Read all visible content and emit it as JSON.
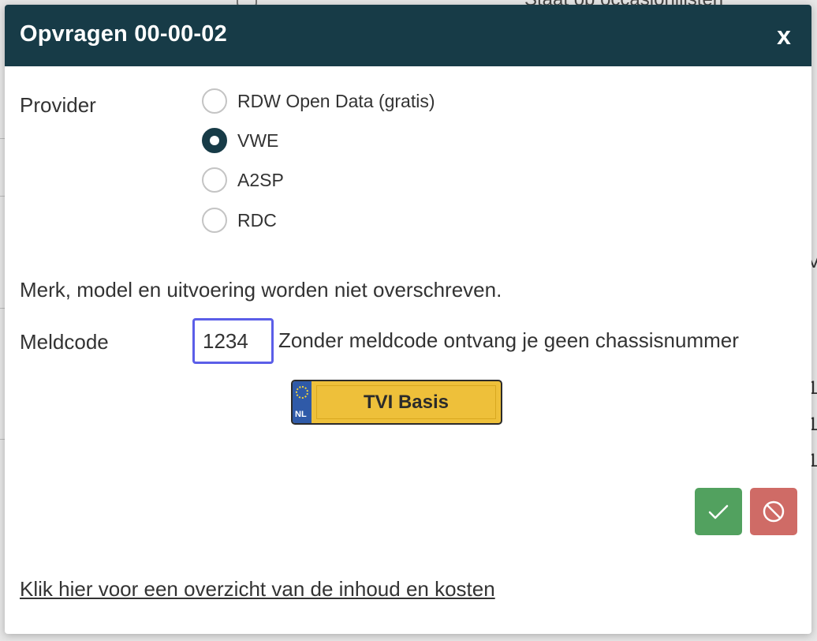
{
  "background": {
    "top_text": "Staat op occasionlijsten",
    "right_glyphs": [
      "V",
      "1",
      "1",
      "1"
    ]
  },
  "modal": {
    "title": "Opvragen 00-00-02",
    "close_label": "x",
    "provider": {
      "label": "Provider",
      "options": [
        {
          "label": "RDW Open Data (gratis)",
          "checked": false
        },
        {
          "label": "VWE",
          "checked": true
        },
        {
          "label": "A2SP",
          "checked": false
        },
        {
          "label": "RDC",
          "checked": false
        }
      ]
    },
    "note": "Merk, model en uitvoering worden niet overschreven.",
    "meldcode": {
      "label": "Meldcode",
      "value": "1234",
      "hint": "Zonder meldcode ontvang je geen chassisnummer"
    },
    "plate": {
      "country": "NL",
      "text": "TVI Basis"
    },
    "buttons": {
      "confirm_icon": "checkmark-icon",
      "cancel_icon": "no-entry-icon"
    },
    "link_text": "Klik hier voor een overzicht van de inhoud en kosten"
  },
  "colors": {
    "header": "#173b47",
    "confirm": "#52a15f",
    "cancel": "#cf6b66",
    "input_border": "#5b5ee8",
    "plate_yellow": "#eec03a",
    "plate_blue": "#2f5aa8"
  }
}
